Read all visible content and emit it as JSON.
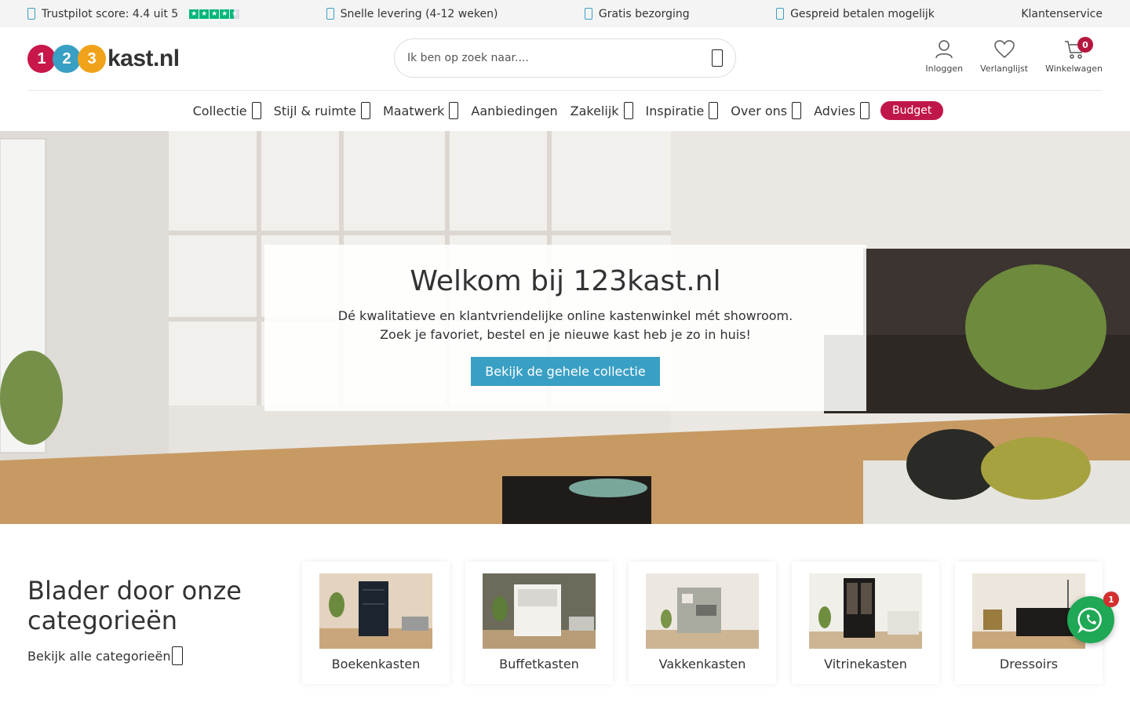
{
  "usp": {
    "trustpilot": "Trustpilot score: 4.4 uit 5",
    "delivery": "Snelle levering (4-12 weken)",
    "shipping": "Gratis bezorging",
    "payment": "Gespreid betalen mogelijk",
    "service": "Klantenservice"
  },
  "logo": {
    "d1": "1",
    "d2": "2",
    "d3": "3",
    "text": "kast.nl"
  },
  "search": {
    "placeholder": "Ik ben op zoek naar...."
  },
  "actions": {
    "login": "Inloggen",
    "wishlist": "Verlanglijst",
    "cart": "Winkelwagen",
    "cart_count": "0"
  },
  "nav": {
    "items": [
      "Collectie",
      "Stijl & ruimte",
      "Maatwerk",
      "Aanbiedingen",
      "Zakelijk",
      "Inspiratie",
      "Over ons",
      "Advies"
    ],
    "budget": "Budget"
  },
  "hero": {
    "title": "Welkom bij 123kast.nl",
    "line1": "Dé kwalitatieve en klantvriendelijke online kastenwinkel mét showroom.",
    "line2": "Zoek je favoriet, bestel en je nieuwe kast heb je zo in huis!",
    "button": "Bekijk de gehele collectie"
  },
  "categories": {
    "title": "Blader door onze categorieën",
    "link": "Bekijk alle categorieën",
    "items": [
      "Boekenkasten",
      "Buffetkasten",
      "Vakkenkasten",
      "Vitrinekasten",
      "Dressoirs"
    ]
  },
  "whatsapp": {
    "badge": "1"
  },
  "colors": {
    "accent": "#3a9fc4",
    "budget": "#c0174a",
    "whatsapp": "#1fa855"
  }
}
